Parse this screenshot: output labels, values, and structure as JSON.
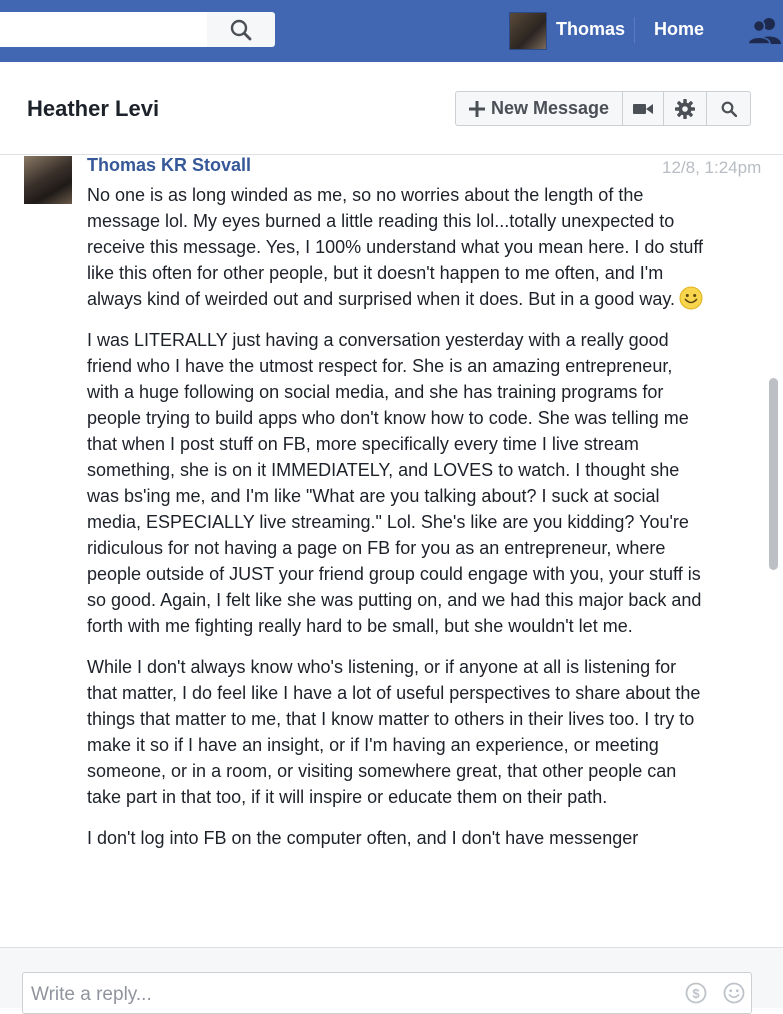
{
  "topbar": {
    "user_name": "Thomas",
    "home_label": "Home",
    "search": {
      "value": "",
      "placeholder": ""
    },
    "icons": [
      "search-icon",
      "friends-icon"
    ],
    "brand_color": "#4267b2"
  },
  "header": {
    "title": "Heather Levi",
    "new_message_label": "New Message",
    "icons": [
      "plus-icon",
      "video-call-icon",
      "gear-icon",
      "search-icon"
    ]
  },
  "message": {
    "author": "Thomas KR Stovall",
    "timestamp": "12/8, 1:24pm",
    "paragraphs": [
      "No one is as long winded as me, so no worries about the length of the message lol. My eyes burned a little reading this lol...totally unexpected to receive this message. Yes, I 100% understand what you mean here. I do stuff like this often for other people, but it doesn't happen to me often, and I'm always kind of weirded out and surprised when it does. But in a good way.",
      "I was LITERALLY just having a conversation yesterday with a really good friend who I have the utmost respect for. She is an amazing entrepreneur, with a huge following on social media, and she has training programs for people trying to build apps who don't know how to code. She was telling me that when I post stuff on FB, more specifically every time I live stream something, she is on it IMMEDIATELY, and LOVES to watch. I thought she was bs'ing me, and I'm like \"What are you talking about? I suck at social media, ESPECIALLY live streaming.\" Lol. She's like are you kidding? You're ridiculous for not having a page on FB for you as an entrepreneur, where people outside of JUST your friend group could engage with you, your stuff is so good. Again, I felt like she was putting on, and we had this major back and forth with me fighting really hard to be small, but she wouldn't let me.",
      "While I don't always know who's listening, or if anyone at all is listening for that matter, I do feel like I have a lot of useful perspectives to share about the things that matter to me, that I know matter to others in their lives too. I try to make it so if I have an insight, or if I'm having an experience, or meeting someone, or in a room, or visiting somewhere great, that other people can take part in that too, if it will inspire or educate them on their path.",
      "I don't log into FB on the computer often, and I don't have messenger"
    ],
    "emoji": "smiley-emoji-icon"
  },
  "reply": {
    "placeholder": "Write a reply...",
    "icons": [
      "dollar-icon",
      "emoji-icon"
    ]
  }
}
